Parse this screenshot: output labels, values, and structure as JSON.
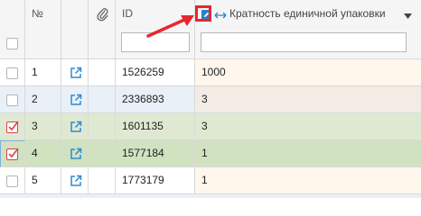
{
  "header": {
    "number_label": "№",
    "id_label": "ID",
    "id_filter_placeholder": "",
    "pack_label": "Кратность единичной упаковки",
    "pack_filter_placeholder": "",
    "pack_icon": "edit-square-icon",
    "resize_icon": "horizontal-resize-arrow-icon",
    "sort_icon": "dropdown-triangle-icon",
    "attach_icon": "paperclip-icon"
  },
  "rows": [
    {
      "num": "1",
      "id": "1526259",
      "pack": "1000",
      "checked": false
    },
    {
      "num": "2",
      "id": "2336893",
      "pack": "3",
      "checked": false
    },
    {
      "num": "3",
      "id": "1601135",
      "pack": "3",
      "checked": true
    },
    {
      "num": "4",
      "id": "1577184",
      "pack": "1",
      "checked": true
    },
    {
      "num": "5",
      "id": "1773179",
      "pack": "1",
      "checked": false
    }
  ],
  "colors": {
    "row_white": "#ffffff",
    "row_blue": "#eaf0f8",
    "row_green": "#dfe9d2",
    "row_green_selected": "#d0e2c0",
    "pack_column_tint": "#fff6ec",
    "annotation_red": "#e8262d",
    "link_icon_blue": "#2c8bd6"
  }
}
